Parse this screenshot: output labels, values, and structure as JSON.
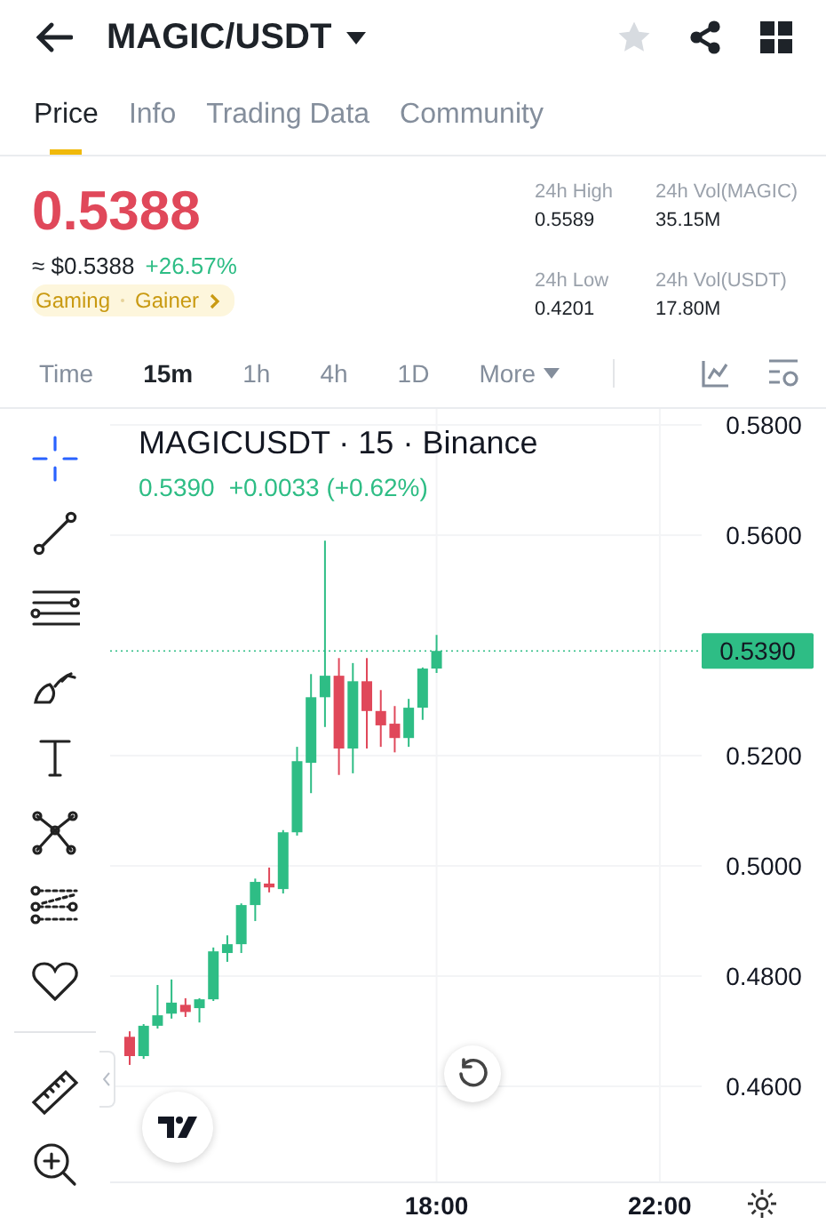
{
  "header": {
    "title": "MAGIC/USDT",
    "favorite": false
  },
  "tabs": [
    {
      "label": "Price",
      "selected": true
    },
    {
      "label": "Info",
      "selected": false
    },
    {
      "label": "Trading Data",
      "selected": false
    },
    {
      "label": "Community",
      "selected": false
    }
  ],
  "price": {
    "last": "0.5388",
    "fiat": "≈ $0.5388",
    "change": "+26.57%",
    "tags": [
      "Gaming",
      "Gainer"
    ]
  },
  "stats": [
    {
      "label": "24h High",
      "value": "0.5589"
    },
    {
      "label": "24h Vol(MAGIC)",
      "value": "35.15M"
    },
    {
      "label": "24h Low",
      "value": "0.4201"
    },
    {
      "label": "24h Vol(USDT)",
      "value": "17.80M"
    }
  ],
  "intervals": [
    {
      "label": "Time",
      "kind": "option",
      "selected": false
    },
    {
      "label": "15m",
      "kind": "option",
      "selected": true
    },
    {
      "label": "1h",
      "kind": "option",
      "selected": false
    },
    {
      "label": "4h",
      "kind": "option",
      "selected": false
    },
    {
      "label": "1D",
      "kind": "option",
      "selected": false
    },
    {
      "label": "More",
      "kind": "menu",
      "selected": false
    }
  ],
  "tools": [
    {
      "kind": "crosshair",
      "selected": true
    },
    {
      "kind": "trend-line",
      "selected": false
    },
    {
      "kind": "parallel-lines",
      "selected": false
    },
    {
      "kind": "brush",
      "selected": false
    },
    {
      "kind": "text",
      "selected": false
    },
    {
      "kind": "pattern",
      "selected": false
    },
    {
      "kind": "fib",
      "selected": false
    },
    {
      "kind": "heart",
      "selected": false
    },
    {
      "kind": "ruler",
      "selected": false
    },
    {
      "kind": "zoom",
      "selected": false
    }
  ],
  "chart": {
    "title": "MAGICUSDT · 15 · Binance",
    "legend_price": "0.5390",
    "legend_change": "+0.0033 (+0.62%)",
    "chart_data": {
      "type": "candlestick",
      "ylim": [
        0.4426,
        0.5829
      ],
      "grid": true,
      "ref_lines": [
        {
          "axis": "y",
          "value": 0.539,
          "label": "0.5390",
          "color": "#2ebd85"
        }
      ],
      "yticks": [
        {
          "value": 0.58,
          "label": "0.5800"
        },
        {
          "value": 0.56,
          "label": "0.5600"
        },
        {
          "value": 0.52,
          "label": "0.5200"
        },
        {
          "value": 0.5,
          "label": "0.5000"
        },
        {
          "value": 0.48,
          "label": "0.4800"
        },
        {
          "value": 0.46,
          "label": "0.4600"
        }
      ],
      "categories": [
        null,
        null,
        null,
        null,
        null,
        null,
        null,
        null,
        null,
        null,
        null,
        null,
        null,
        null,
        null,
        null,
        null,
        null,
        null,
        null,
        null,
        null,
        "18:00",
        null,
        null,
        null,
        null,
        null,
        null,
        null,
        null,
        null,
        null,
        null,
        null,
        null,
        null,
        null,
        "22:00"
      ],
      "ohlc": [
        [
          0.469,
          0.47,
          0.4639,
          0.4655
        ],
        [
          0.4655,
          0.4713,
          0.465,
          0.471
        ],
        [
          0.471,
          0.4784,
          0.4705,
          0.4729
        ],
        [
          0.4732,
          0.4794,
          0.4723,
          0.4752
        ],
        [
          0.4748,
          0.476,
          0.4726,
          0.4735
        ],
        [
          0.4742,
          0.476,
          0.4716,
          0.4758
        ],
        [
          0.4758,
          0.4852,
          0.4755,
          0.4845
        ],
        [
          0.4842,
          0.4874,
          0.4826,
          0.4858
        ],
        [
          0.4858,
          0.4932,
          0.4842,
          0.4929
        ],
        [
          0.4929,
          0.4977,
          0.49,
          0.4971
        ],
        [
          0.4968,
          0.4997,
          0.4952,
          0.4961
        ],
        [
          0.4958,
          0.5065,
          0.495,
          0.5061
        ],
        [
          0.5061,
          0.5216,
          0.5055,
          0.519
        ],
        [
          0.5187,
          0.5348,
          0.5132,
          0.5306
        ],
        [
          0.5306,
          0.559,
          0.5252,
          0.5345
        ],
        [
          0.5345,
          0.5377,
          0.5165,
          0.5213
        ],
        [
          0.5213,
          0.5368,
          0.5168,
          0.5335
        ],
        [
          0.5335,
          0.5377,
          0.5213,
          0.5281
        ],
        [
          0.5281,
          0.5319,
          0.5216,
          0.5255
        ],
        [
          0.5258,
          0.529,
          0.5206,
          0.5232
        ],
        [
          0.5232,
          0.5303,
          0.5216,
          0.5287
        ],
        [
          0.5287,
          0.536,
          0.5265,
          0.5358
        ],
        [
          0.5358,
          0.5419,
          0.535,
          0.539
        ],
        null,
        null,
        null,
        null,
        null,
        null,
        null,
        null,
        null,
        null,
        null,
        null,
        null,
        null,
        null,
        null
      ]
    }
  }
}
